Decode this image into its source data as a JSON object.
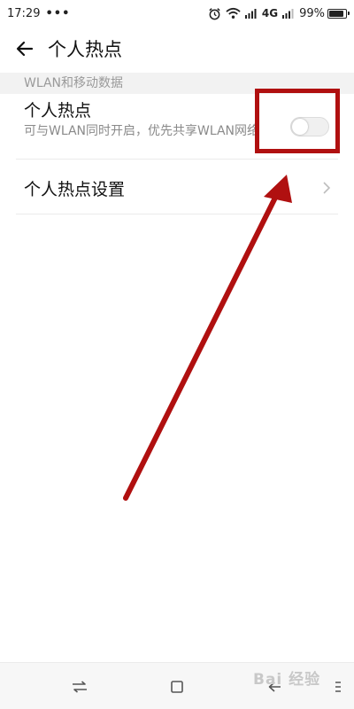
{
  "status_bar": {
    "time": "17:29",
    "dots": "•••",
    "network": "4G",
    "battery_text": "99%",
    "battery_level": 0.99
  },
  "toolbar": {
    "title": "个人热点"
  },
  "section": {
    "header": "WLAN和移动数据"
  },
  "hotspot": {
    "title": "个人热点",
    "description": "可与WLAN同时开启，优先共享WLAN网络",
    "enabled": false
  },
  "settings": {
    "label": "个人热点设置"
  },
  "watermark": {
    "text": "Bai 经验"
  },
  "colors": {
    "annotation": "#b01010",
    "section_bg": "#f2f2f2",
    "secondary_text": "#8a8a8a"
  },
  "icons": [
    "alarm-icon",
    "wifi-icon",
    "signal-icon",
    "battery-icon",
    "back-arrow-icon",
    "chevron-right-icon",
    "switch-apps-icon",
    "home-icon",
    "back-icon",
    "menu-icon"
  ]
}
